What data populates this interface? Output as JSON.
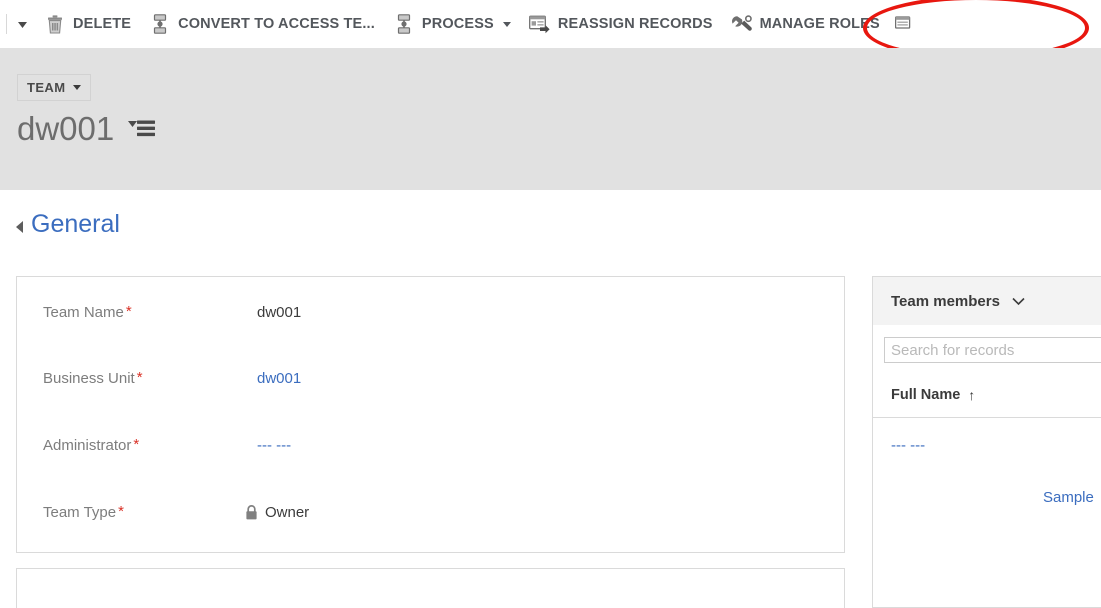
{
  "command_bar": {
    "overflow_left_icon": "chevron-down-icon",
    "buttons": [
      {
        "label": "DELETE",
        "icon": "trash-icon",
        "has_caret": false
      },
      {
        "label": "CONVERT TO ACCESS TE...",
        "icon": "convert-team-icon",
        "has_caret": false
      },
      {
        "label": "PROCESS",
        "icon": "process-icon",
        "has_caret": true
      },
      {
        "label": "REASSIGN RECORDS",
        "icon": "reassign-records-icon",
        "has_caret": false
      },
      {
        "label": "MANAGE ROLES",
        "icon": "wrench-icon",
        "has_caret": false
      }
    ],
    "overflow_right_icon": "more-commands-icon"
  },
  "annotation": {
    "target": "MANAGE ROLES",
    "shape": "ellipse",
    "color": "#e8170f"
  },
  "record_header": {
    "entity_type": "TEAM",
    "entity_type_caret": "caret-down-icon",
    "record_title": "dw001",
    "form_selector_icon": "form-selector-icon"
  },
  "general_section": {
    "title": "General",
    "collapse_icon": "collapse-triangle-icon",
    "fields": [
      {
        "label": "Team Name",
        "required": true,
        "value": "dw001",
        "value_type": "text",
        "icon": null
      },
      {
        "label": "Business Unit",
        "required": true,
        "value": "dw001",
        "value_type": "link",
        "icon": null
      },
      {
        "label": "Administrator",
        "required": true,
        "value": "--- ---",
        "value_type": "link",
        "icon": null
      },
      {
        "label": "Team Type",
        "required": true,
        "value": "Owner",
        "value_type": "text",
        "icon": "lock-icon"
      }
    ]
  },
  "team_members_panel": {
    "title": "Team members",
    "chevron_icon": "chevron-down-icon",
    "search_placeholder": "Search for records",
    "search_value": "",
    "column_header": "Full Name",
    "sort_indicator": "↑",
    "rows": [
      {
        "name": "--- ---"
      },
      {
        "name": "Sample"
      }
    ]
  },
  "colors": {
    "accent_link": "#3b6dbf",
    "required_star": "#d93025",
    "header_band": "#e1e1e1",
    "annotation_red": "#e8170f"
  }
}
